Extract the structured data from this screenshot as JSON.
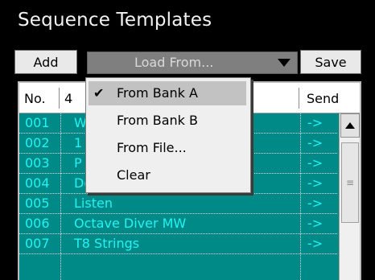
{
  "title": "Sequence Templates",
  "toolbar": {
    "add_label": "Add",
    "load_label": "Load From...",
    "save_label": "Save"
  },
  "table": {
    "columns": {
      "no": "No.",
      "name": "4",
      "send": "Send"
    },
    "rows": [
      {
        "num": "001",
        "name": "W",
        "send": "->"
      },
      {
        "num": "002",
        "name": "1",
        "send": "->"
      },
      {
        "num": "003",
        "name": "P",
        "send": "->"
      },
      {
        "num": "004",
        "name": "Double Arp",
        "send": "->"
      },
      {
        "num": "005",
        "name": "Listen",
        "send": "->"
      },
      {
        "num": "006",
        "name": "Octave Diver MW",
        "send": "->"
      },
      {
        "num": "007",
        "name": "T8 Strings",
        "send": "->"
      }
    ]
  },
  "menu": {
    "items": [
      {
        "label": "From Bank A",
        "checked": true,
        "check": "✔"
      },
      {
        "label": "From Bank B",
        "checked": false,
        "check": ""
      },
      {
        "label": "From File...",
        "checked": false,
        "check": ""
      },
      {
        "label": "Clear",
        "checked": false,
        "check": ""
      }
    ]
  },
  "colors": {
    "list_bg": "#008a87",
    "row_text": "#22f3f3",
    "background": "#000000"
  }
}
